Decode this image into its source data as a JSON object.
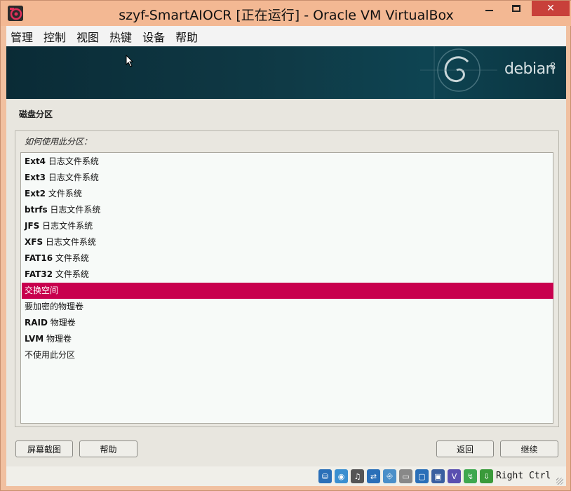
{
  "window": {
    "title": "szyf-SmartAIOCR [正在运行] - Oracle VM VirtualBox"
  },
  "menubar": {
    "items": [
      "管理",
      "控制",
      "视图",
      "热键",
      "设备",
      "帮助"
    ]
  },
  "banner": {
    "logo_text": "debian",
    "version": "8"
  },
  "installer": {
    "section_title": "磁盘分区",
    "prompt": "如何使用此分区：",
    "options": [
      {
        "bold": "Ext4",
        "rest": " 日志文件系统"
      },
      {
        "bold": "Ext3",
        "rest": " 日志文件系统"
      },
      {
        "bold": "Ext2",
        "rest": " 文件系统"
      },
      {
        "bold": "btrfs",
        "rest": " 日志文件系统"
      },
      {
        "bold": "JFS",
        "rest": " 日志文件系统"
      },
      {
        "bold": "XFS",
        "rest": " 日志文件系统"
      },
      {
        "bold": "FAT16",
        "rest": " 文件系统"
      },
      {
        "bold": "FAT32",
        "rest": " 文件系统"
      },
      {
        "bold": "",
        "rest": "交换空间"
      },
      {
        "bold": "",
        "rest": "要加密的物理卷"
      },
      {
        "bold": "RAID",
        "rest": " 物理卷"
      },
      {
        "bold": "LVM",
        "rest": " 物理卷"
      },
      {
        "bold": "",
        "rest": "不使用此分区"
      }
    ],
    "selected_index": 8,
    "buttons": {
      "screenshot": "屏幕截图",
      "help": "帮助",
      "back": "返回",
      "continue": "继续"
    }
  },
  "statusbar": {
    "host_key": "Right Ctrl",
    "icons": [
      "hard-disk-icon",
      "optical-drive-icon",
      "audio-icon",
      "network-icon",
      "usb-icon",
      "shared-folder-icon",
      "display-icon",
      "video-capture-icon",
      "virtualization-icon",
      "mouse-integration-icon",
      "keyboard-capture-icon"
    ]
  },
  "colors": {
    "selection": "#c8004e",
    "banner": "#0f3a46",
    "title_bar": "#f3b893",
    "close_button": "#c8403a"
  }
}
